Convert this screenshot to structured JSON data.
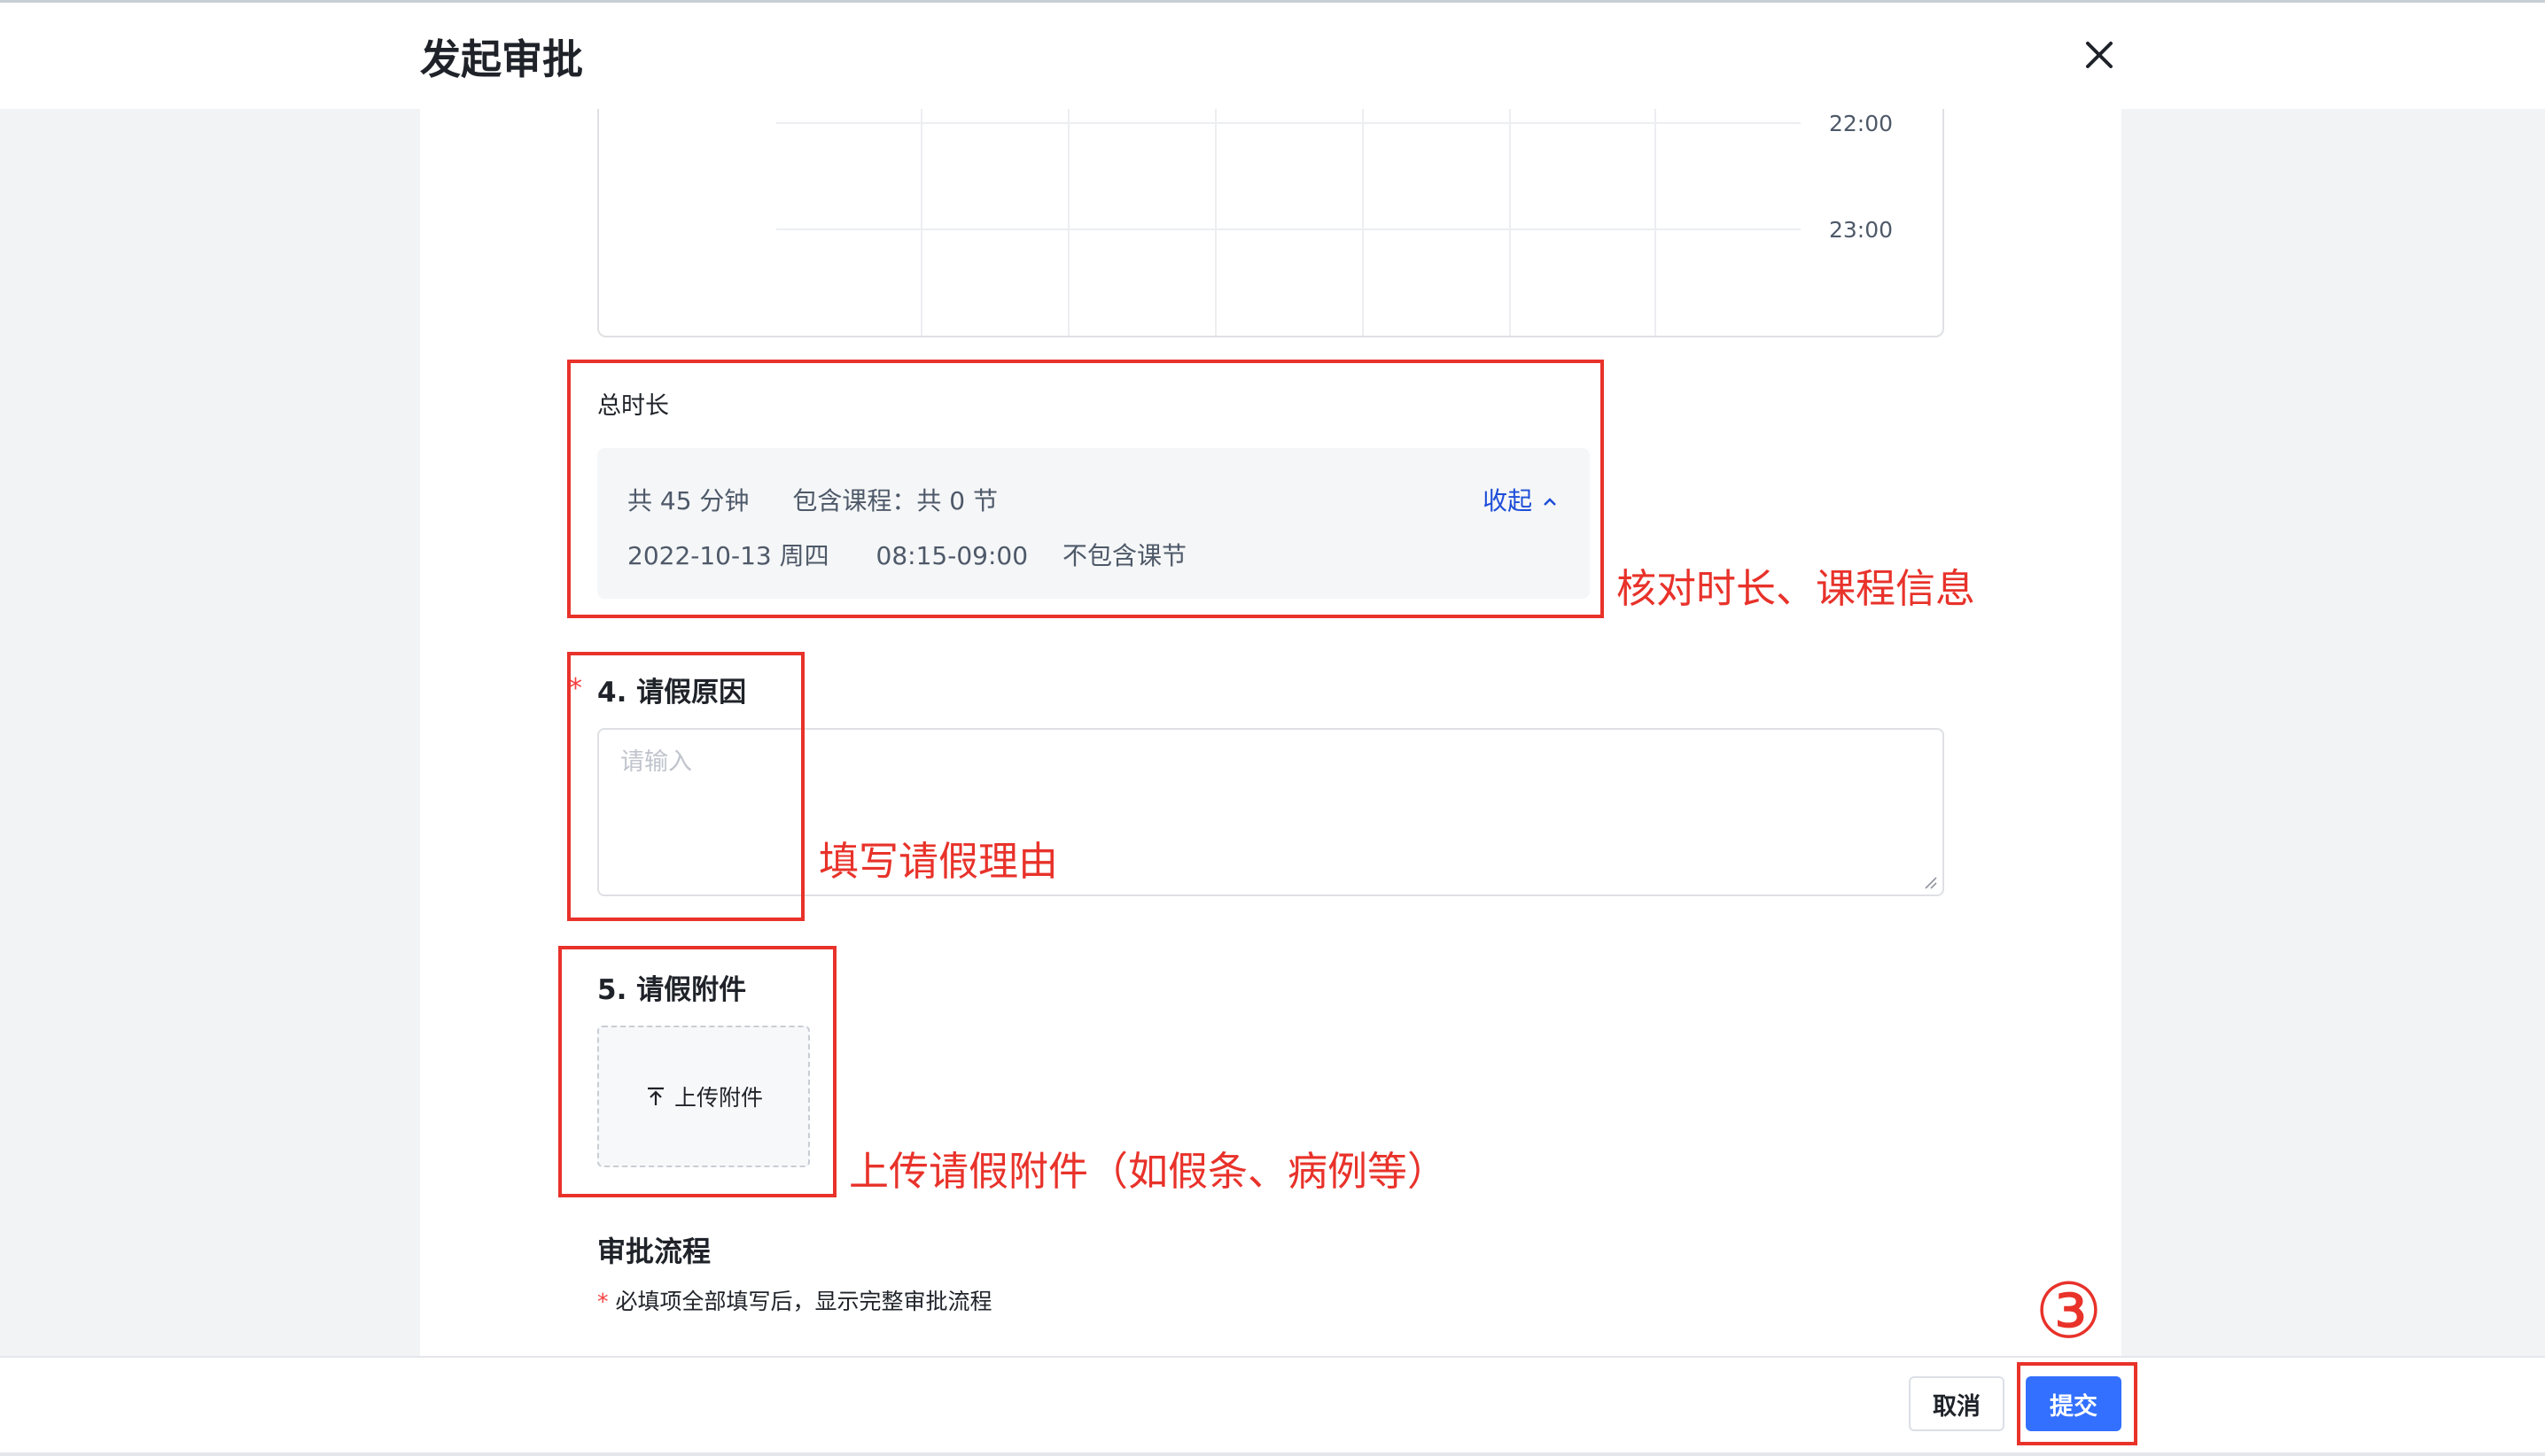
{
  "dialog": {
    "title": "发起审批"
  },
  "calendar": {
    "times": [
      "22:00",
      "23:00"
    ]
  },
  "duration": {
    "label": "总时长",
    "total": "共 45 分钟",
    "courses": "包含课程：共 0 节",
    "collapse": "收起",
    "date": "2022-10-13 周四",
    "range": "08:15-09:00",
    "course_note": "不包含课节"
  },
  "reason": {
    "title": "4. 请假原因",
    "required_mark": "*",
    "placeholder": "请输入"
  },
  "attachment": {
    "title": "5. 请假附件",
    "upload_label": "上传附件"
  },
  "flow": {
    "title": "审批流程",
    "note_star": "*",
    "note": "必填项全部填写后，显示完整审批流程"
  },
  "footer": {
    "cancel": "取消",
    "submit": "提交"
  },
  "annotations": {
    "duration": "核对时长、课程信息",
    "reason": "填写请假理由",
    "attachment": "上传请假附件（如假条、病例等）",
    "step": "③"
  },
  "colors": {
    "accent": "#3370ff",
    "annotation": "#e8322a",
    "link": "#1d4ed8"
  }
}
